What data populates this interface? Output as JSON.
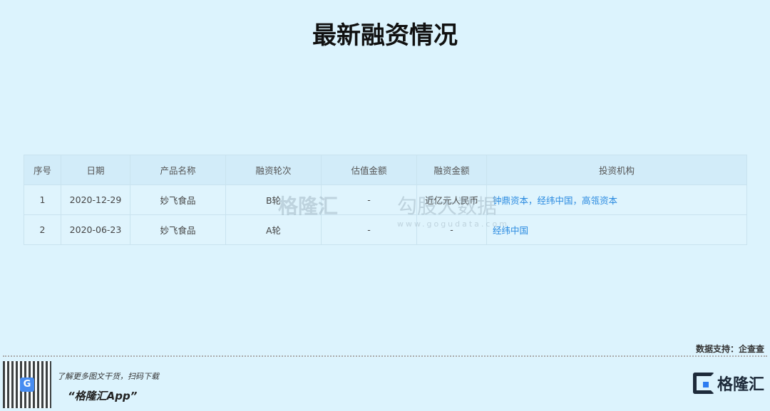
{
  "title": "最新融资情况",
  "table": {
    "headers": [
      "序号",
      "日期",
      "产品名称",
      "融资轮次",
      "估值金额",
      "融资金额",
      "投资机构"
    ],
    "rows": [
      {
        "no": "1",
        "date": "2020-12-29",
        "product": "妙飞食品",
        "round": "B轮",
        "valuation": "-",
        "amount": "近亿元人民币",
        "investors": "钟鼎资本，经纬中国，高瓴资本"
      },
      {
        "no": "2",
        "date": "2020-06-23",
        "product": "妙飞食品",
        "round": "A轮",
        "valuation": "-",
        "amount": "-",
        "investors": "经纬中国"
      }
    ]
  },
  "watermark": {
    "brand": "格隆汇",
    "data": "勾股大数据",
    "url": "www.gogudata.com"
  },
  "source": "数据支持：企查查",
  "footer": {
    "promo_line": "了解更多图文干货，扫码下载",
    "app_name": "“格隆汇App”",
    "logo_text": "格隆汇"
  },
  "colors": {
    "background": "#dcf3fd",
    "link": "#2a8ae0"
  }
}
